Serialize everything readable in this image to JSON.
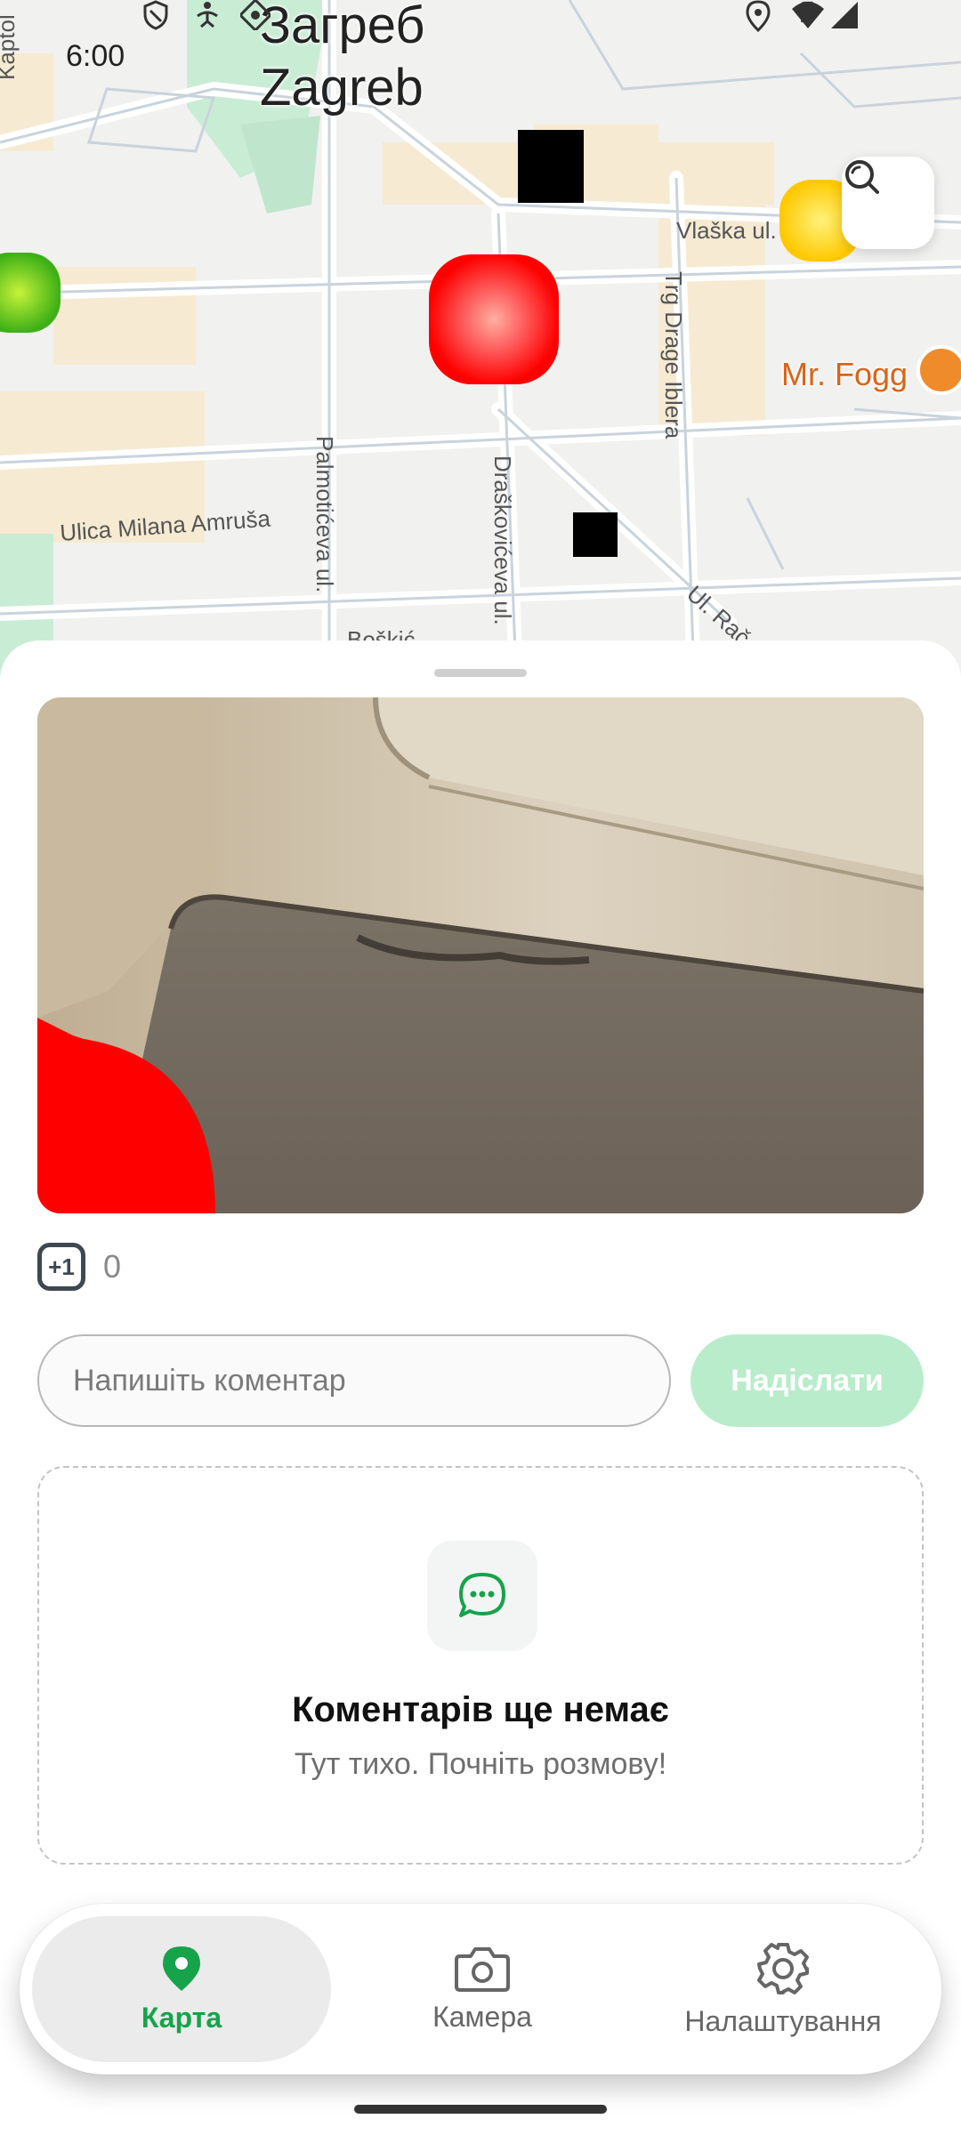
{
  "status_bar": {
    "time": "6:00"
  },
  "map": {
    "city_name_cyrillic": "Загреб",
    "city_name_latin": "Zagreb",
    "poi_label": "Mr. Fogg",
    "streets": {
      "vlaska": "Vlaška ul.",
      "trg_drage_iblera": "Trg Drage Iblera",
      "palmoticeva": "Palmotićeva ul.",
      "draskoviceva": "Draškovićeva ul.",
      "milana_amrusa": "Ulica Milana Amruša",
      "radiceva": "Ul. Rač",
      "kaptol": "Kaptol",
      "top_right": "ul.",
      "partial_bottom": "Boškić"
    },
    "search_icon": "search-icon",
    "marker_colors": {
      "red": "#ff1a1a",
      "yellow": "#ffd400",
      "green": "#4cc21a",
      "black": "#000000"
    }
  },
  "post": {
    "vote_label": "+1",
    "vote_count": "0"
  },
  "comment": {
    "placeholder": "Напишіть коментар",
    "send_label": "Надіслати"
  },
  "empty_state": {
    "icon": "chat-bubble-icon",
    "title": "Коментарів ще немає",
    "subtitle": "Тут тихо. Почніть розмову!"
  },
  "nav": {
    "map_label": "Карта",
    "camera_label": "Камера",
    "settings_label": "Налаштування",
    "accent_color": "#16a34a"
  }
}
